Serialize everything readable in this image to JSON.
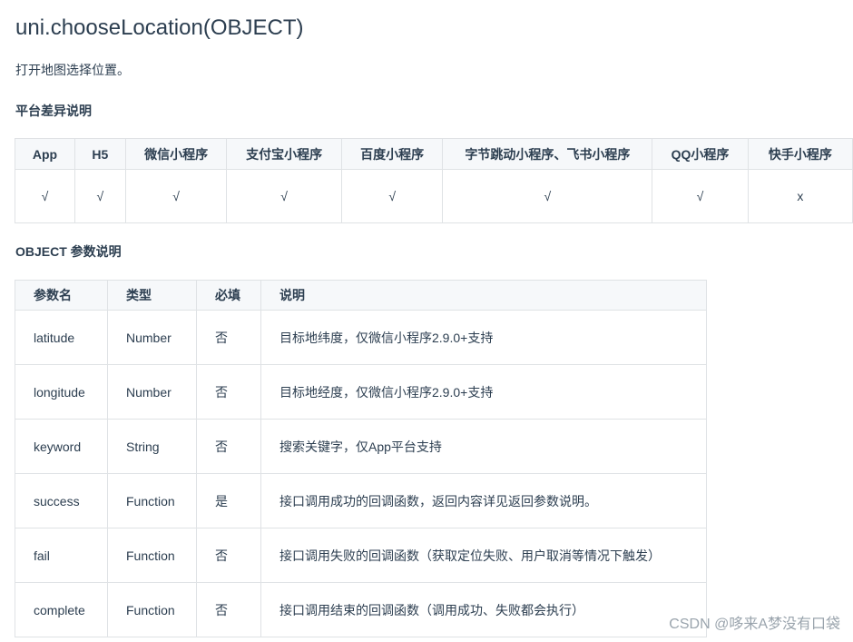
{
  "title": "uni.chooseLocation(OBJECT)",
  "intro": "打开地图选择位置。",
  "platform_heading": "平台差异说明",
  "platform_table": {
    "headers": [
      "App",
      "H5",
      "微信小程序",
      "支付宝小程序",
      "百度小程序",
      "字节跳动小程序、飞书小程序",
      "QQ小程序",
      "快手小程序"
    ],
    "values": [
      "√",
      "√",
      "√",
      "√",
      "√",
      "√",
      "√",
      "x"
    ]
  },
  "object_heading": "OBJECT 参数说明",
  "param_table": {
    "headers": [
      "参数名",
      "类型",
      "必填",
      "说明"
    ],
    "rows": [
      [
        "latitude",
        "Number",
        "否",
        "目标地纬度，仅微信小程序2.9.0+支持"
      ],
      [
        "longitude",
        "Number",
        "否",
        "目标地经度，仅微信小程序2.9.0+支持"
      ],
      [
        "keyword",
        "String",
        "否",
        "搜索关键字，仅App平台支持"
      ],
      [
        "success",
        "Function",
        "是",
        "接口调用成功的回调函数，返回内容详见返回参数说明。"
      ],
      [
        "fail",
        "Function",
        "否",
        "接口调用失败的回调函数（获取定位失败、用户取消等情况下触发）"
      ],
      [
        "complete",
        "Function",
        "否",
        "接口调用结束的回调函数（调用成功、失败都会执行）"
      ]
    ]
  },
  "watermark": "CSDN @哆来A梦没有口袋"
}
